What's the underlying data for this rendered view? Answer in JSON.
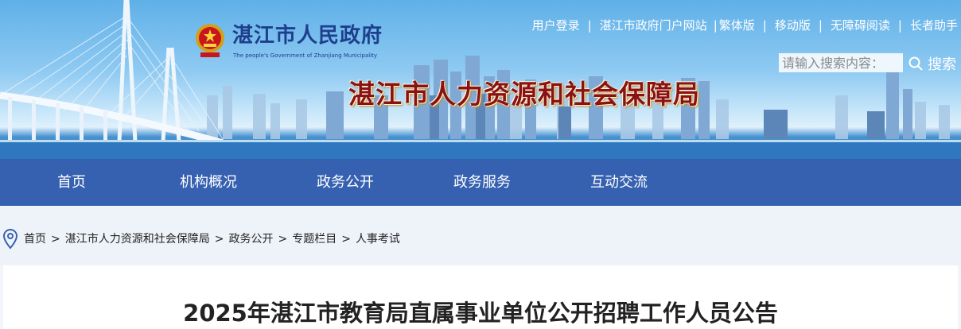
{
  "header": {
    "gov_name": "湛江市人民政府",
    "gov_name_en": "The people's Government of Zhanjiang Municipality",
    "bureau_title": "湛江市人力资源和社会保障局",
    "emblem_icon": "national-emblem-icon"
  },
  "top_links": {
    "login": "用户登录",
    "portal": "湛江市政府门户网站",
    "traditional": "繁体版",
    "mobile": "移动版",
    "accessible": "无障碍阅读",
    "elderly": "长者助手",
    "separator": "|"
  },
  "search": {
    "placeholder": "请输入搜索内容：",
    "button_label": "搜索",
    "icon": "search-icon"
  },
  "nav": {
    "items": [
      {
        "label": "首页"
      },
      {
        "label": "机构概况"
      },
      {
        "label": "政务公开"
      },
      {
        "label": "政务服务"
      },
      {
        "label": "互动交流"
      }
    ]
  },
  "breadcrumb": {
    "icon": "location-pin-icon",
    "separator": ">",
    "items": [
      "首页",
      "湛江市人力资源和社会保障局",
      "政务公开",
      "专题栏目",
      "人事考试"
    ]
  },
  "article": {
    "title": "2025年湛江市教育局直属事业单位公开招聘工作人员公告"
  },
  "colors": {
    "nav_bg": "#3661b1",
    "crumb_bg": "#eef3f9",
    "bureau_title": "#8a1214",
    "gov_name": "#1e3f8c"
  }
}
